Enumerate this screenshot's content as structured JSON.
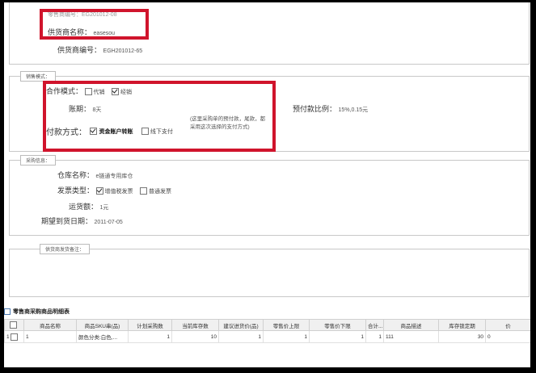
{
  "supplier": {
    "top_partial": "零售商编号：EG201012-08",
    "name_label": "供货商名称：",
    "name_value": "easesou",
    "code_label": "供货商编号：",
    "code_value": "EGH201012-65"
  },
  "sales": {
    "legend": "销售模式：",
    "coop_label": "合作模式：",
    "coop_options": [
      {
        "label": "代销",
        "checked": false
      },
      {
        "label": "经销",
        "checked": true
      }
    ],
    "term_label": "账期：",
    "term_value": "8天",
    "prepay_label": "预付款比例：",
    "prepay_value": "15%,0.15元",
    "pay_label": "付款方式：",
    "pay_options": [
      {
        "label": "资金账户转账",
        "checked": true
      },
      {
        "label": "线下支付",
        "checked": false
      }
    ],
    "pay_note": "(这里采购单的预付款，尾款，都采用这次选择的支付方式)"
  },
  "purchase": {
    "legend": "采购信息：",
    "warehouse_label": "仓库名称：",
    "warehouse_value": "e链通专用库仓",
    "invoice_label": "发票类型：",
    "invoice_options": [
      {
        "label": "增值税发票",
        "checked": true
      },
      {
        "label": "普通发票",
        "checked": false
      }
    ],
    "freight_label": "运货额：",
    "freight_value": "1元",
    "date_label": "期望到货日期：",
    "date_value": "2011-07-05"
  },
  "remark": {
    "legend": "供货商发货备注："
  },
  "grid": {
    "title": "零售商采购商品明细表",
    "columns": [
      "",
      "商品名称",
      "商品SKU串(品)",
      "计划采购数",
      "当前库存数",
      "建议进货价(品)",
      "零售价上限",
      "零售价下限",
      "合计...",
      "商品描述",
      "库存锁定期",
      "价"
    ],
    "rows": [
      [
        "1",
        "1",
        "颜色分类:白色,...",
        "1",
        "10",
        "1",
        "1",
        "1",
        "1",
        "111",
        "30",
        "0"
      ]
    ]
  }
}
